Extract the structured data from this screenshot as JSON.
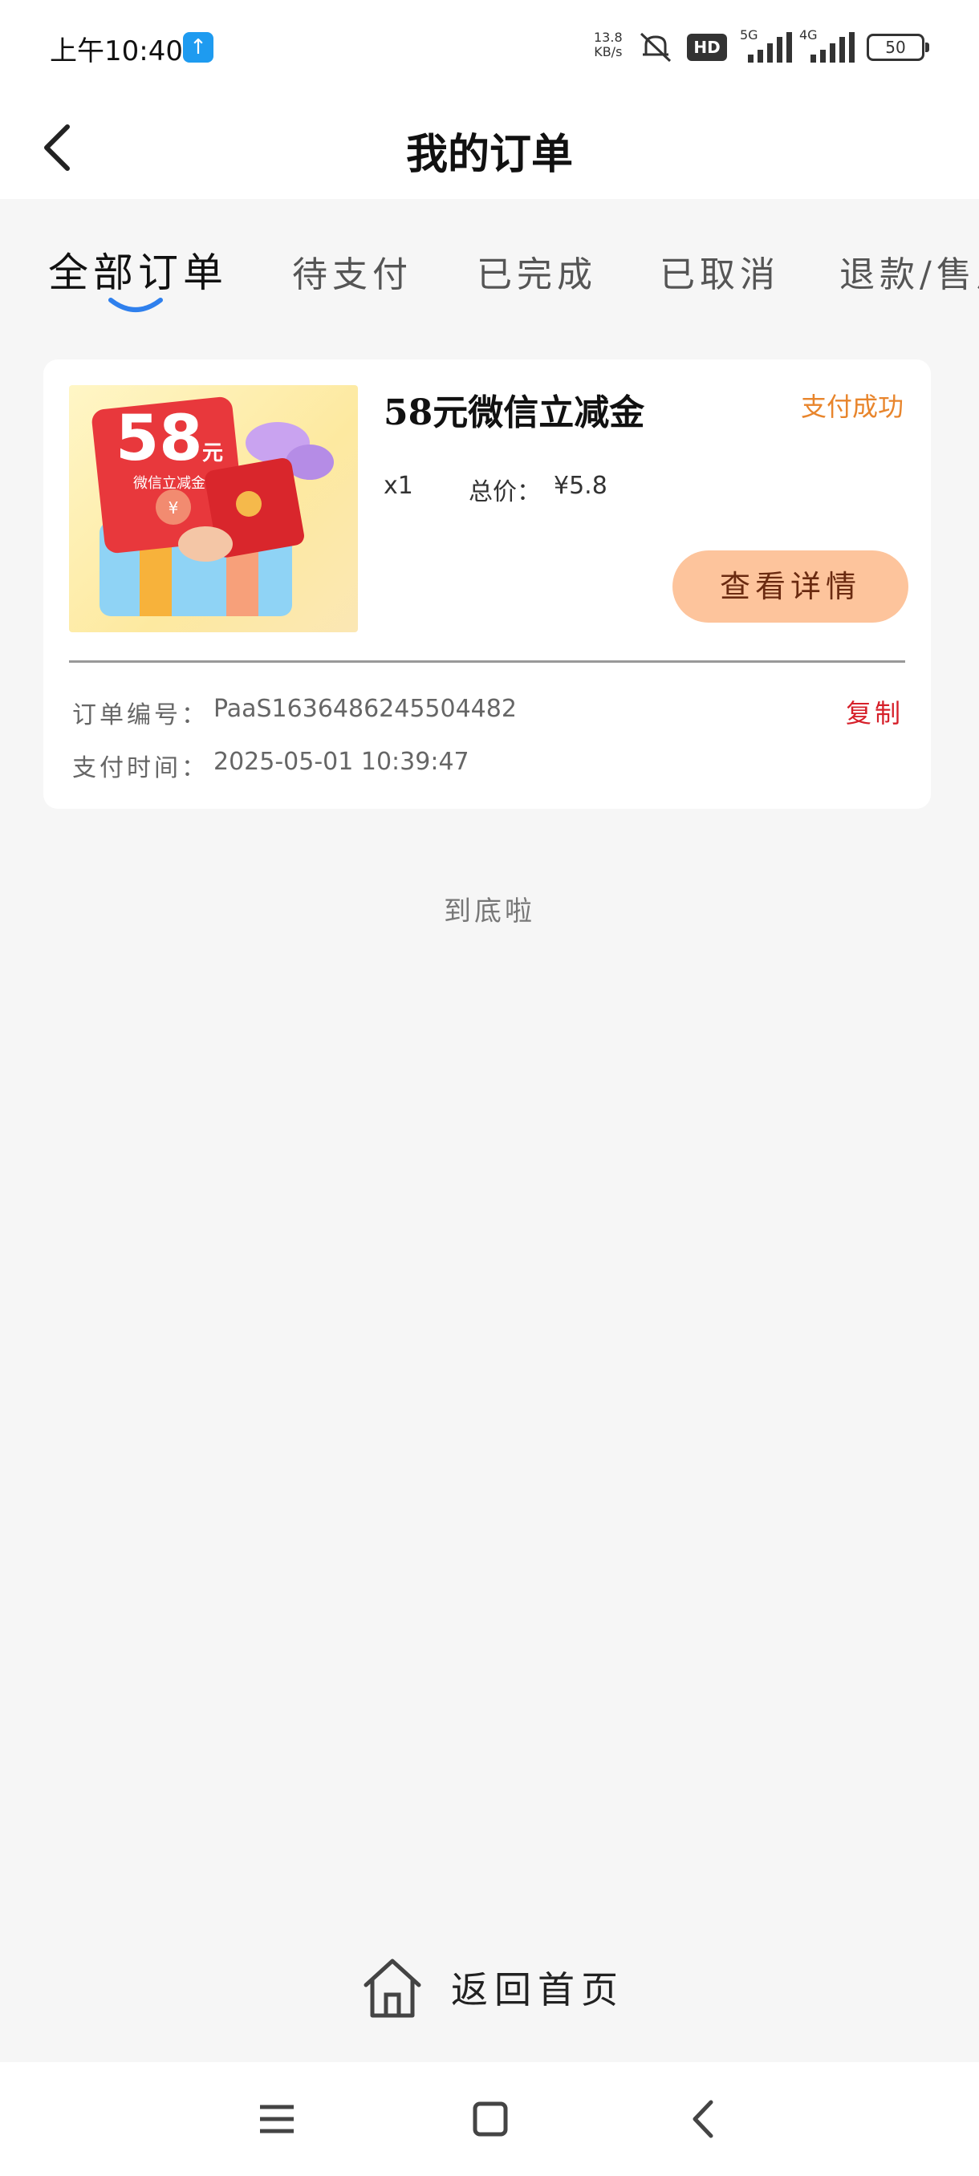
{
  "status_bar": {
    "time": "上午10:40",
    "net_speed_value": "13.8",
    "net_speed_unit": "KB/s",
    "hd": "HD",
    "net_type_1": "5G",
    "net_type_2": "4G",
    "battery": "50"
  },
  "header": {
    "title": "我的订单"
  },
  "tabs": [
    {
      "label": "全部订单",
      "active": true
    },
    {
      "label": "待支付"
    },
    {
      "label": "已完成"
    },
    {
      "label": "已取消"
    },
    {
      "label": "退款/售后"
    }
  ],
  "order": {
    "thumb_amount": "58",
    "thumb_unit": "元",
    "thumb_caption": "微信立减金",
    "name": "58元微信立减金",
    "status": "支付成功",
    "quantity": "x1",
    "total_label": "总价：",
    "total_value": "¥5.8",
    "detail_button": "查看详情",
    "order_no_label": "订单编号：",
    "order_no": "PaaS1636486245504482",
    "copy_label": "复制",
    "pay_time_label": "支付时间：",
    "pay_time": "2025-05-01 10:39:47"
  },
  "end_text": "到底啦",
  "footer": {
    "home_label": "返回首页"
  },
  "colors": {
    "accent_orange": "#e8852c",
    "detail_button_bg": "#fdc49c",
    "copy_red": "#d6202a",
    "tab_indicator": "#2f80ed"
  }
}
